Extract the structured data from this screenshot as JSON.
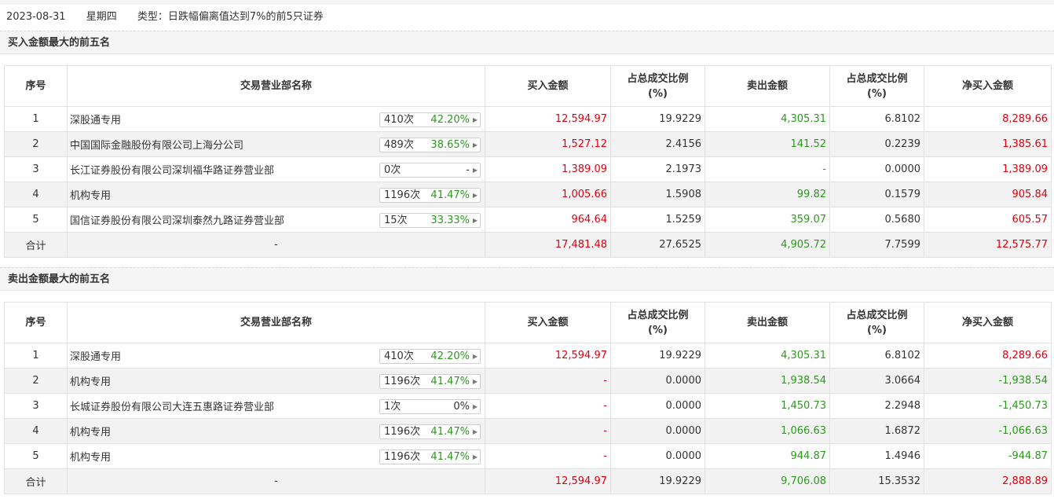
{
  "header": {
    "date": "2023-08-31",
    "weekday": "星期四",
    "type_label": "类型：",
    "type_value": "日跌幅偏离值达到7%的前5只证券"
  },
  "columns": {
    "seq": "序号",
    "dept": "交易营业部名称",
    "buy": "买入金额",
    "buy_ratio_1": "占总成交比例",
    "buy_ratio_2": "(%)",
    "sell": "卖出金额",
    "sell_ratio_1": "占总成交比例",
    "sell_ratio_2": "(%)",
    "net": "净买入金额"
  },
  "colors": {
    "up": "#e3000e",
    "down": "#2b9a1c"
  },
  "icons": {
    "pill_arrow": "caret-right-icon"
  },
  "buy_top5": {
    "title": "买入金额最大的前五名",
    "rows": [
      {
        "seq": "1",
        "name": "深股通专用",
        "count": "410次",
        "rate": "42.20%",
        "buy": "12,594.97",
        "buy_ratio": "19.9229",
        "sell": "4,305.31",
        "sell_ratio": "6.8102",
        "net": "8,289.66"
      },
      {
        "seq": "2",
        "name": "中国国际金融股份有限公司上海分公司",
        "count": "489次",
        "rate": "38.65%",
        "buy": "1,527.12",
        "buy_ratio": "2.4156",
        "sell": "141.52",
        "sell_ratio": "0.2239",
        "net": "1,385.61"
      },
      {
        "seq": "3",
        "name": "长江证券股份有限公司深圳福华路证券营业部",
        "count": "0次",
        "rate": "-",
        "buy": "1,389.09",
        "buy_ratio": "2.1973",
        "sell": "-",
        "sell_ratio": "0.0000",
        "net": "1,389.09"
      },
      {
        "seq": "4",
        "name": "机构专用",
        "count": "1196次",
        "rate": "41.47%",
        "buy": "1,005.66",
        "buy_ratio": "1.5908",
        "sell": "99.82",
        "sell_ratio": "0.1579",
        "net": "905.84"
      },
      {
        "seq": "5",
        "name": "国信证券股份有限公司深圳泰然九路证券营业部",
        "count": "15次",
        "rate": "33.33%",
        "buy": "964.64",
        "buy_ratio": "1.5259",
        "sell": "359.07",
        "sell_ratio": "0.5680",
        "net": "605.57"
      }
    ],
    "total": {
      "label": "合计",
      "name": "-",
      "buy": "17,481.48",
      "buy_ratio": "27.6525",
      "sell": "4,905.72",
      "sell_ratio": "7.7599",
      "net": "12,575.77"
    }
  },
  "sell_top5": {
    "title": "卖出金额最大的前五名",
    "rows": [
      {
        "seq": "1",
        "name": "深股通专用",
        "count": "410次",
        "rate": "42.20%",
        "buy": "12,594.97",
        "buy_ratio": "19.9229",
        "sell": "4,305.31",
        "sell_ratio": "6.8102",
        "net": "8,289.66"
      },
      {
        "seq": "2",
        "name": "机构专用",
        "count": "1196次",
        "rate": "41.47%",
        "buy": "-",
        "buy_ratio": "0.0000",
        "sell": "1,938.54",
        "sell_ratio": "3.0664",
        "net": "-1,938.54"
      },
      {
        "seq": "3",
        "name": "长城证券股份有限公司大连五惠路证券营业部",
        "count": "1次",
        "rate": "0%",
        "buy": "-",
        "buy_ratio": "0.0000",
        "sell": "1,450.73",
        "sell_ratio": "2.2948",
        "net": "-1,450.73"
      },
      {
        "seq": "4",
        "name": "机构专用",
        "count": "1196次",
        "rate": "41.47%",
        "buy": "-",
        "buy_ratio": "0.0000",
        "sell": "1,066.63",
        "sell_ratio": "1.6872",
        "net": "-1,066.63"
      },
      {
        "seq": "5",
        "name": "机构专用",
        "count": "1196次",
        "rate": "41.47%",
        "buy": "-",
        "buy_ratio": "0.0000",
        "sell": "944.87",
        "sell_ratio": "1.4946",
        "net": "-944.87"
      }
    ],
    "total": {
      "label": "合计",
      "name": "-",
      "buy": "12,594.97",
      "buy_ratio": "19.9229",
      "sell": "9,706.08",
      "sell_ratio": "15.3532",
      "net": "2,888.89"
    }
  }
}
